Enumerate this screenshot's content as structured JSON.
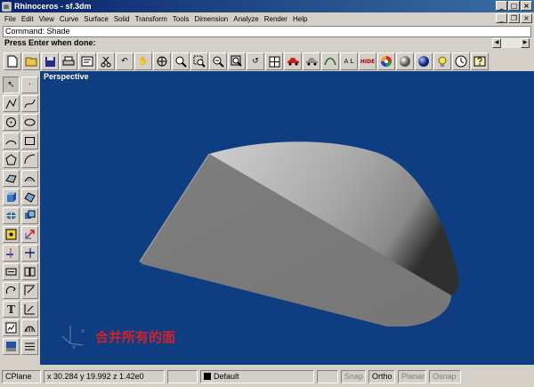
{
  "window": {
    "title": "Rhinoceros - sf.3dm"
  },
  "window_controls": {
    "minimize": "_",
    "maximize": "□",
    "close": "×"
  },
  "doc_controls": {
    "minimize": "_",
    "restore": "❐",
    "close": "×"
  },
  "menu": {
    "items": [
      "File",
      "Edit",
      "View",
      "Curve",
      "Surface",
      "Solid",
      "Transform",
      "Tools",
      "Dimension",
      "Analyze",
      "Render",
      "Help"
    ]
  },
  "command": {
    "history": "Command: Shade",
    "prompt": "Press Enter when done:"
  },
  "viewport": {
    "title": "Perspective",
    "caption": "合并所有的面",
    "background": "#0f3d82"
  },
  "status": {
    "cplane": "CPlane",
    "coords": "x 30.284  y 19.992  z 1.42e0",
    "layer": "Default",
    "snap": "Snap",
    "ortho": "Ortho",
    "planar": "Planar",
    "osnap": "Osnap"
  }
}
